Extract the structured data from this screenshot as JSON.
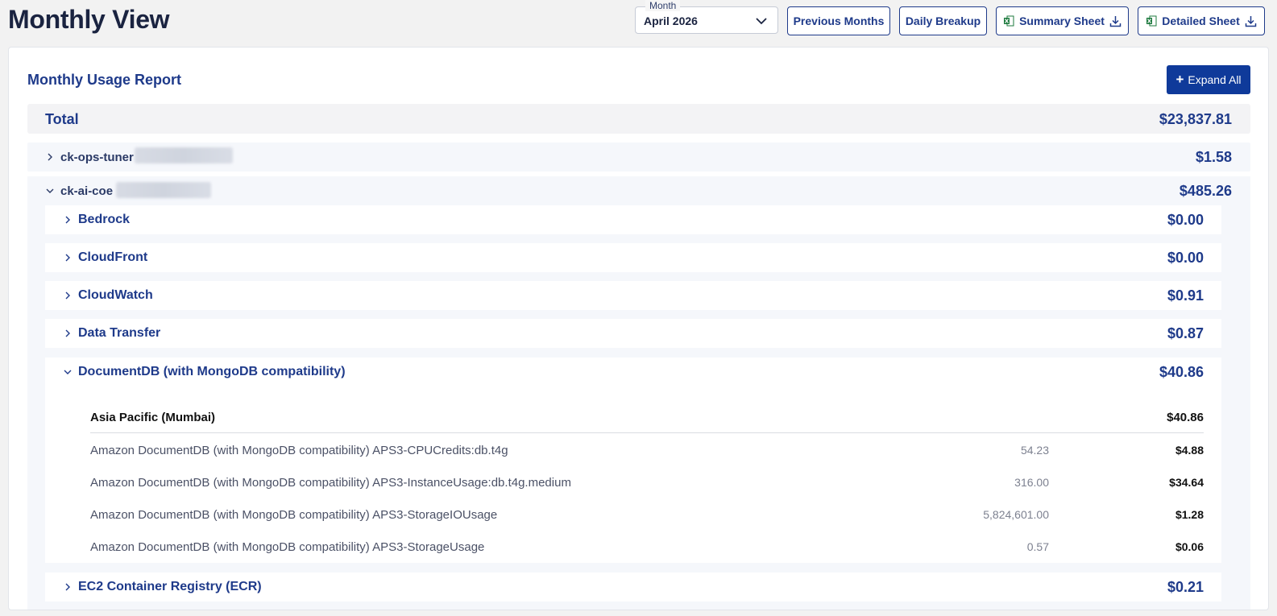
{
  "header": {
    "title": "Monthly View",
    "month_label": "Month",
    "month_value": "April 2026",
    "buttons": {
      "previous_months": "Previous Months",
      "daily_breakup": "Daily Breakup",
      "summary_sheet": "Summary Sheet",
      "detailed_sheet": "Detailed Sheet"
    }
  },
  "report": {
    "title": "Monthly Usage Report",
    "expand_all": "Expand All",
    "total_label": "Total",
    "total_value": "$23,837.81",
    "accounts": [
      {
        "name": "ck-ops-tuner",
        "cost": "$1.58",
        "expanded": false
      },
      {
        "name": "ck-ai-coe",
        "cost": "$485.26",
        "expanded": true,
        "services": [
          {
            "name": "Bedrock",
            "cost": "$0.00"
          },
          {
            "name": "CloudFront",
            "cost": "$0.00"
          },
          {
            "name": "CloudWatch",
            "cost": "$0.91"
          },
          {
            "name": "Data Transfer",
            "cost": "$0.87"
          },
          {
            "name": "DocumentDB (with MongoDB compatibility)",
            "cost": "$40.86",
            "region": {
              "name": "Asia Pacific (Mumbai)",
              "cost": "$40.86"
            },
            "items": [
              {
                "desc": "Amazon DocumentDB (with MongoDB compatibility) APS3-CPUCredits:db.t4g",
                "qty": "54.23",
                "cost": "$4.88"
              },
              {
                "desc": "Amazon DocumentDB (with MongoDB compatibility) APS3-InstanceUsage:db.t4g.medium",
                "qty": "316.00",
                "cost": "$34.64"
              },
              {
                "desc": "Amazon DocumentDB (with MongoDB compatibility) APS3-StorageIOUsage",
                "qty": "5,824,601.00",
                "cost": "$1.28"
              },
              {
                "desc": "Amazon DocumentDB (with MongoDB compatibility) APS3-StorageUsage",
                "qty": "0.57",
                "cost": "$0.06"
              }
            ]
          },
          {
            "name": "EC2 Container Registry (ECR)",
            "cost": "$0.21"
          }
        ]
      }
    ]
  },
  "colors": {
    "brand_blue": "#1e3a8a",
    "primary_button": "#0f3a9a",
    "excel_green": "#1d7a3e"
  },
  "icons": [
    "chevron-down-icon",
    "chevron-right-icon",
    "excel-icon",
    "download-icon",
    "plus-icon"
  ]
}
